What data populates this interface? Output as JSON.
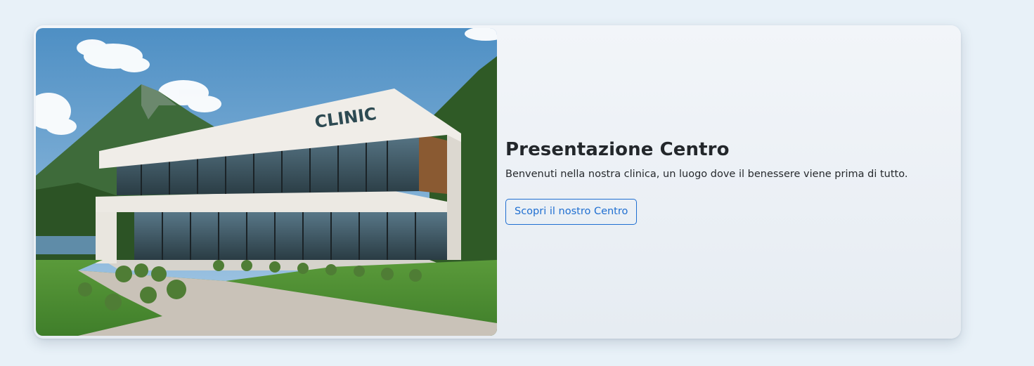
{
  "hero": {
    "image_alt": "Clinic building",
    "image_sign": "CLINIC",
    "title": "Presentazione Centro",
    "description": "Benvenuti nella nostra clinica, un luogo dove il benessere viene prima di tutto.",
    "cta_label": "Scopri il nostro Centro"
  },
  "colors": {
    "page_bg": "#e8f1f8",
    "accent": "#1f6fd1",
    "title_text": "#23272b"
  }
}
